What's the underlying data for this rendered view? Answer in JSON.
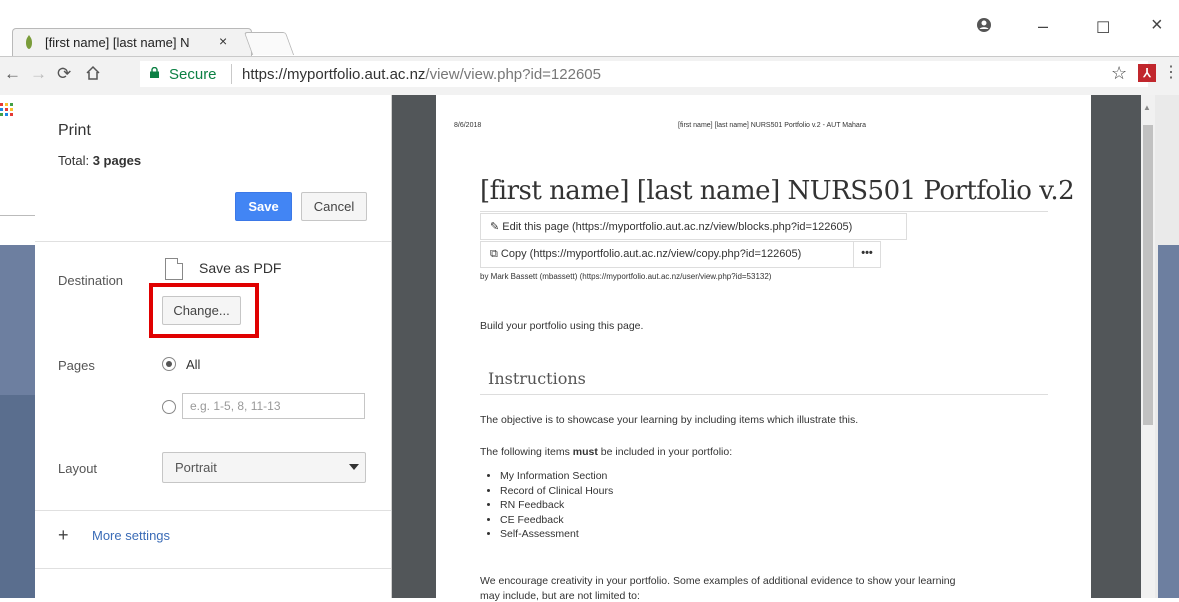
{
  "browser": {
    "tab_title": "[first name] [last name] N",
    "tab_close": "×",
    "window_controls": {
      "profile": "profile-icon",
      "minimize": "–",
      "maximize": "☐",
      "close": "×"
    },
    "security_label": "Secure",
    "url_host": "https://myportfolio.aut.ac.nz",
    "url_path": "/view/view.php?id=122605"
  },
  "print": {
    "title": "Print",
    "total_label": "Total:",
    "total_value": "3 pages",
    "save_label": "Save",
    "cancel_label": "Cancel",
    "destination_label": "Destination",
    "destination_value": "Save as PDF",
    "change_label": "Change...",
    "pages_label": "Pages",
    "pages_all_label": "All",
    "pages_range_placeholder": "e.g. 1-5, 8, 11-13",
    "layout_label": "Layout",
    "layout_value": "Portrait",
    "more_settings_label": "More settings"
  },
  "preview": {
    "header_date": "8/6/2018",
    "header_title": "[first name] [last name] NURS501 Portfolio v.2 - AUT Mahara",
    "heading": "[first name] [last name] NURS501 Portfolio v.2",
    "edit_link": "Edit this page (https://myportfolio.aut.ac.nz/view/blocks.php?id=122605)",
    "copy_link": "Copy (https://myportfolio.aut.ac.nz/view/copy.php?id=122605)",
    "more_label": "•••",
    "byline": "by Mark Bassett (mbassett) (https://myportfolio.aut.ac.nz/user/view.php?id=53132)",
    "intro": "Build your portfolio using this page.",
    "section_heading": "Instructions",
    "objective": "The objective is to showcase your learning by including items which illustrate this.",
    "must_prefix": "The following items ",
    "must_word": "must",
    "must_suffix": " be included in your portfolio:",
    "items": [
      "My Information Section",
      "Record of Clinical Hours",
      "RN Feedback",
      "CE Feedback",
      "Self-Assessment"
    ],
    "encourage": "We encourage creativity in your portfolio.  Some examples of additional evidence to show your learning",
    "encourage_cont": "may include, but are not limited to:"
  },
  "colors": {
    "accent": "#4285f4",
    "highlight": "#e00000",
    "secure": "#0b8043",
    "link": "#3b6cb7"
  }
}
